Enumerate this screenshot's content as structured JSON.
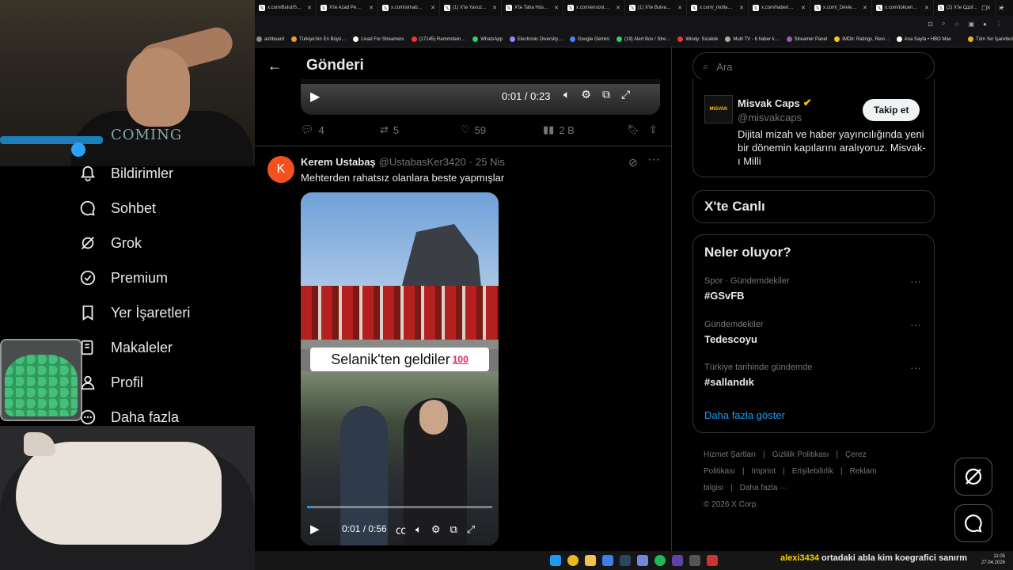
{
  "browser": {
    "tabs": [
      "x.com/Bulut/S…",
      "X'te Azad Pe…",
      "x.com/simab…",
      "(1) X'te Yavuz…",
      "X'te Taha Hüs…",
      "x.com/ensoni…",
      "(1) X'te Bulva…",
      "x.com/_molla…",
      "x.com/haberi…",
      "x.com/_Devle…",
      "x.com/tokcen…",
      "(2) X'te Conf…"
    ],
    "bookmarks": [
      "ashboard",
      "Türkiye'nin En Büyü…",
      "Livad For Streamers",
      "(17145) Rammstein…",
      "WhatsApp",
      "Electronic Diversity…",
      "Google Gemini",
      "(19) Alert Box / Stre…",
      "Windy: Sıcaklık",
      "Multi TV - 6 haber k…",
      "Streamer Panel",
      "IMDb: Ratings, Revi…",
      "Ana Sayfa • HBO Max",
      "Tüm Yer İşaretleri"
    ]
  },
  "nav": {
    "items": [
      {
        "label": "Bildirimler",
        "icon": "bell-icon"
      },
      {
        "label": "Sohbet",
        "icon": "chat-icon"
      },
      {
        "label": "Grok",
        "icon": "grok-icon"
      },
      {
        "label": "Premium",
        "icon": "premium-icon"
      },
      {
        "label": "Yer İşaretleri",
        "icon": "bookmark-icon"
      },
      {
        "label": "Makaleler",
        "icon": "article-icon"
      },
      {
        "label": "Profil",
        "icon": "profile-icon"
      },
      {
        "label": "Daha fazla",
        "icon": "more-circle-icon"
      }
    ]
  },
  "overlay": {
    "shirt_text": "COMING"
  },
  "header": {
    "title": "Gönderi"
  },
  "post1": {
    "video_time": "0:01 / 0:23",
    "replies": "4",
    "reposts": "5",
    "likes": "59",
    "views": "2 B"
  },
  "post2": {
    "avatar_letter": "K",
    "name": "Kerem Ustabaş",
    "handle": "@UstabasKer3420",
    "dot": "·",
    "time": "25 Nis",
    "text": "Mehterden rahatsız olanlara beste yapmışlar",
    "caption": "Selanik'ten geldiler",
    "caption_emoji": "100",
    "video_time": "0:01 / 0:56",
    "video_progress": 0.02
  },
  "search": {
    "placeholder": "Ara"
  },
  "promo": {
    "logo_text": "MISVAK",
    "name": "Misvak Caps",
    "handle": "@misvakcaps",
    "follow": "Takip et",
    "bio": "Dijital mizah ve haber yayıncılığında yeni bir dönemin kapılarını aralıyoruz. Misvak-ı Milli"
  },
  "live": {
    "title": "X'te Canlı"
  },
  "trends": {
    "title": "Neler oluyor?",
    "items": [
      {
        "meta": "Spor · Gündemdekiler",
        "tag": "#GSvFB"
      },
      {
        "meta": "Gündemdekiler",
        "tag": "Tedescoyu"
      },
      {
        "meta": "Türkiye tarihinde gündemde",
        "tag": "#sallandık"
      }
    ],
    "show_more": "Daha fazla göster"
  },
  "footer": {
    "links": [
      "Hizmet Şartları",
      "|",
      "Gizlilik Politikası",
      "|",
      "Çerez Politikası",
      "|",
      "Imprint",
      "|",
      "Erişilebilirlik",
      "|",
      "Reklam bilgisi",
      "|",
      "Daha fazla ···"
    ],
    "copyright": "© 2026 X Corp."
  },
  "chat": {
    "user": "alexi3434",
    "message": "ortadaki abla kim koegrafici sanırm"
  },
  "clock": {
    "time": "11:05",
    "date": "27.04.2026"
  },
  "colors": {
    "accent": "#1d9bf0",
    "avatar": "#f4511e",
    "verified": "#f5c400"
  }
}
